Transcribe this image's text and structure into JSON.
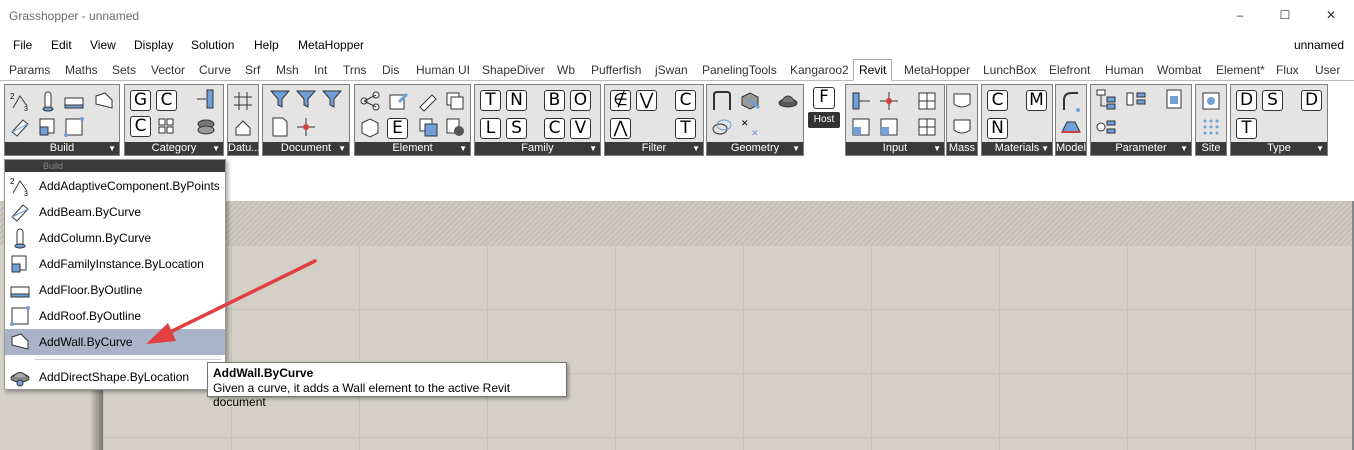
{
  "window": {
    "title": "Grasshopper - unnamed",
    "minimize": "–",
    "maximize": "☐",
    "close": "✕"
  },
  "menubar": {
    "items": [
      "File",
      "Edit",
      "View",
      "Display",
      "Solution",
      "Help",
      "MetaHopper"
    ],
    "document_name": "unnamed"
  },
  "tabs": [
    "Params",
    "Maths",
    "Sets",
    "Vector",
    "Curve",
    "Srf",
    "Msh",
    "Int",
    "Trns",
    "Dis",
    "Human UI",
    "ShapeDiver",
    "Wb",
    "Pufferfish",
    "jSwan",
    "PanelingTools",
    "Kangaroo2",
    "Revit",
    "MetaHopper",
    "LunchBox",
    "Elefront",
    "Human",
    "Wombat",
    "Element*",
    "Flux",
    "User"
  ],
  "active_tab": "Revit",
  "ribbon": {
    "groups": [
      "Build",
      "Category",
      "Datu...",
      "Document",
      "Element",
      "Family",
      "Filter",
      "Geometry",
      "Input",
      "Mass",
      "Materials",
      "Model",
      "Parameter",
      "Site",
      "Type"
    ],
    "category_letters": [
      "G",
      "C",
      "C"
    ],
    "element_letters": [
      "E"
    ],
    "family_letters": [
      "T",
      "N",
      "B",
      "O",
      "L",
      "S",
      "C",
      "V"
    ],
    "filter_letters": [
      "∉",
      "⋁",
      "C",
      "⋀",
      "T"
    ],
    "host_letter": "F",
    "host_label": "Host",
    "materials_letters": [
      "C",
      "M",
      "N"
    ],
    "type_letters": [
      "D",
      "S",
      "D",
      "T"
    ]
  },
  "dropdown": {
    "header": "Build",
    "items": [
      {
        "label": "AddAdaptiveComponent.ByPoints",
        "icon": "adaptive-component-icon"
      },
      {
        "label": "AddBeam.ByCurve",
        "icon": "beam-icon"
      },
      {
        "label": "AddColumn.ByCurve",
        "icon": "column-icon"
      },
      {
        "label": "AddFamilyInstance.ByLocation",
        "icon": "family-instance-icon"
      },
      {
        "label": "AddFloor.ByOutline",
        "icon": "floor-icon"
      },
      {
        "label": "AddRoof.ByOutline",
        "icon": "roof-icon"
      },
      {
        "label": "AddWall.ByCurve",
        "icon": "wall-icon"
      },
      {
        "label": "AddDirectShape.ByLocation",
        "icon": "direct-shape-icon"
      }
    ],
    "highlighted": "AddWall.ByCurve"
  },
  "tooltip": {
    "title": "AddWall.ByCurve",
    "description": "Given a curve, it adds a Wall element to the active Revit document"
  },
  "colors": {
    "ribbon_label_bg": "#3a3a3a",
    "highlight": "#aab4c8",
    "arrow": "#e04040",
    "canvas": "#d4d0c8"
  }
}
